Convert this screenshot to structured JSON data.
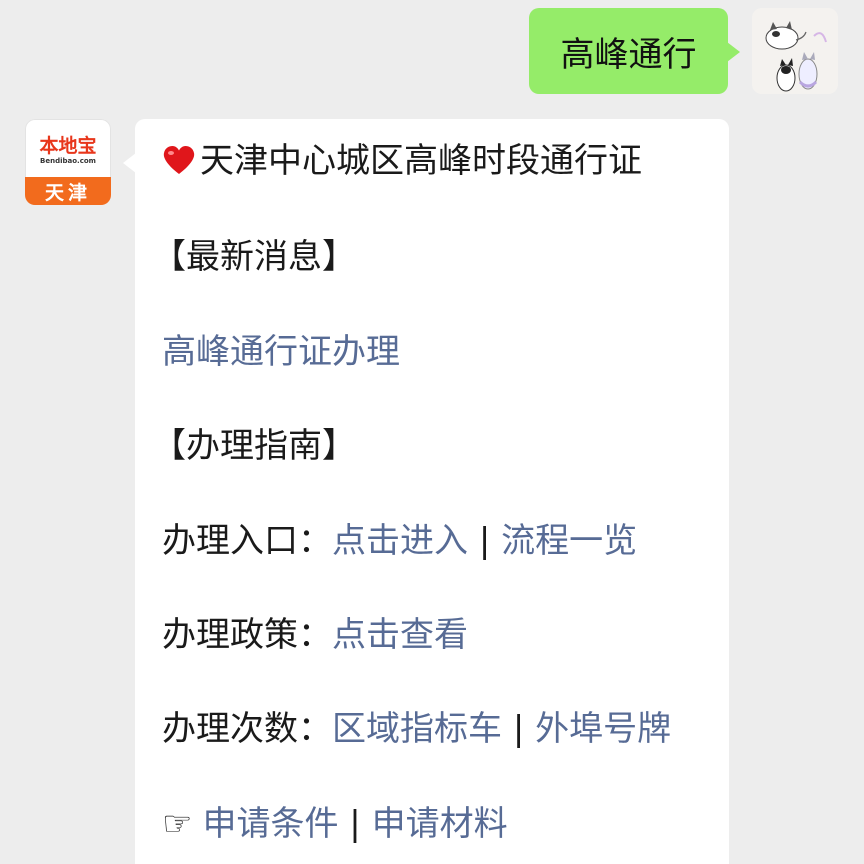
{
  "outgoing": {
    "text": "高峰通行"
  },
  "sender": {
    "avatar_logo": "本地宝",
    "avatar_url": "Bendibao.com",
    "avatar_city": "天津"
  },
  "article": {
    "title": "天津中心城区高峰时段通行证",
    "heart_icon": "red-heart-icon",
    "section_news": "【最新消息】",
    "news_link": "高峰通行证办理",
    "section_guide": "【办理指南】",
    "entry_label": "办理入口：",
    "entry_link1": "点击进入",
    "entry_sep": "|",
    "entry_link2": "流程一览",
    "policy_label": "办理政策：",
    "policy_link": "点击查看",
    "count_label": "办理次数：",
    "count_link1": "区域指标车",
    "count_sep": "|",
    "count_link2": "外埠号牌",
    "apply_icon": "☞",
    "apply_link1": "申请条件",
    "apply_sep": "|",
    "apply_link2": "申请材料"
  },
  "colors": {
    "link": "#576b95",
    "outgoing_bubble": "#95ec69",
    "background": "#ededed",
    "avatar_orange": "#f26b1d"
  }
}
